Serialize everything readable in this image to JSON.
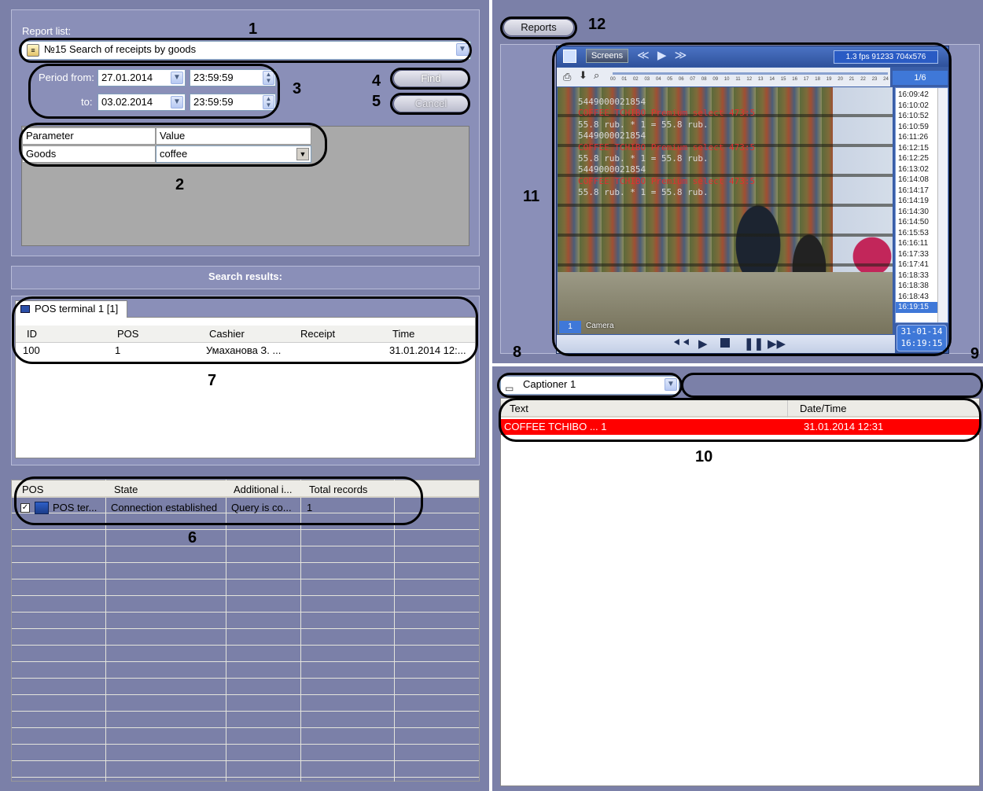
{
  "report_panel": {
    "report_list_label": "Report list:",
    "report_selected": "№15 Search of receipts by goods",
    "period_from_label": "Period from:",
    "to_label": "to:",
    "from_date": "27.01.2014",
    "from_time": "23:59:59",
    "to_date": "03.02.2014",
    "to_time": "23:59:59",
    "find_label": "Find",
    "cancel_label": "Cancel",
    "param_headers": [
      "Parameter",
      "Value"
    ],
    "param_name": "Goods",
    "param_value": "coffee"
  },
  "search_results": {
    "title": "Search results:",
    "tab_label": "POS terminal 1 [1]",
    "headers": [
      "ID",
      "POS",
      "Cashier",
      "Receipt",
      "Time"
    ],
    "rows": [
      {
        "id": "100",
        "pos": "1",
        "cashier": "Умаханова З. ...",
        "receipt": "",
        "time": "31.01.2014 12:..."
      }
    ]
  },
  "pos_table": {
    "headers": [
      "POS",
      "State",
      "Additional i...",
      "Total records"
    ],
    "rows": [
      {
        "pos": "POS ter...",
        "state": "Connection established",
        "additional": "Query is co...",
        "total": "1"
      }
    ]
  },
  "reports_button": "Reports",
  "video": {
    "screens_label": "Screens",
    "fps_info": "1.3 fps  91233 704x576",
    "page": "1/6",
    "camera_num": "1",
    "camera_label": "Camera",
    "date": "31-01-14",
    "time": "16:19:15",
    "timeline_hours": [
      "00",
      "01",
      "02",
      "03",
      "04",
      "05",
      "06",
      "07",
      "08",
      "09",
      "10",
      "11",
      "12",
      "13",
      "14",
      "15",
      "16",
      "17",
      "18",
      "19",
      "20",
      "21",
      "22",
      "23",
      "24"
    ],
    "events": [
      "16:09:42",
      "16:10:02",
      "16:10:52",
      "16:10:59",
      "16:11:26",
      "16:12:15",
      "16:12:25",
      "16:13:02",
      "16:14:08",
      "16:14:17",
      "16:14:19",
      "16:14:30",
      "16:14:50",
      "16:15:53",
      "16:16:11",
      "16:17:33",
      "16:17:41",
      "16:18:33",
      "16:18:38",
      "16:18:43",
      "16:19:15"
    ],
    "selected_event": "16:19:15",
    "overlay": [
      {
        "text": "5449000021854",
        "color": "#d8d8d8"
      },
      {
        "text": "COFFEE TCHIBO Premium select 473:5",
        "color": "#e03030"
      },
      {
        "text": "55.8 rub. * 1 = 55.8 rub.",
        "color": "#d8d8d8"
      },
      {
        "text": "5449000021854",
        "color": "#d8d8d8"
      },
      {
        "text": "COFFEE TCHIBO Premium select 473:5",
        "color": "#e03030"
      },
      {
        "text": "55.8 rub. * 1 = 55.8 rub.",
        "color": "#d8d8d8"
      },
      {
        "text": "5449000021854",
        "color": "#d8d8d8"
      },
      {
        "text": "COFFEE TCHIBO Premium select 473:5",
        "color": "#e03030"
      },
      {
        "text": "55.8 rub. * 1 = 55.8 rub.",
        "color": "#d8d8d8"
      }
    ]
  },
  "captioner": {
    "selected": "Captioner 1",
    "headers": [
      "Text",
      "Date/Time"
    ],
    "rows": [
      {
        "text": "COFFEE TCHIBO ...  1",
        "datetime": "31.01.2014 12:31"
      }
    ]
  },
  "callouts": [
    "1",
    "2",
    "3",
    "4",
    "5",
    "6",
    "7",
    "8",
    "9",
    "10",
    "11",
    "12"
  ],
  "colors": {
    "panel": "#8a8fb8",
    "highlight_row": "#ff0000",
    "selected_blue": "#3f78d8"
  }
}
